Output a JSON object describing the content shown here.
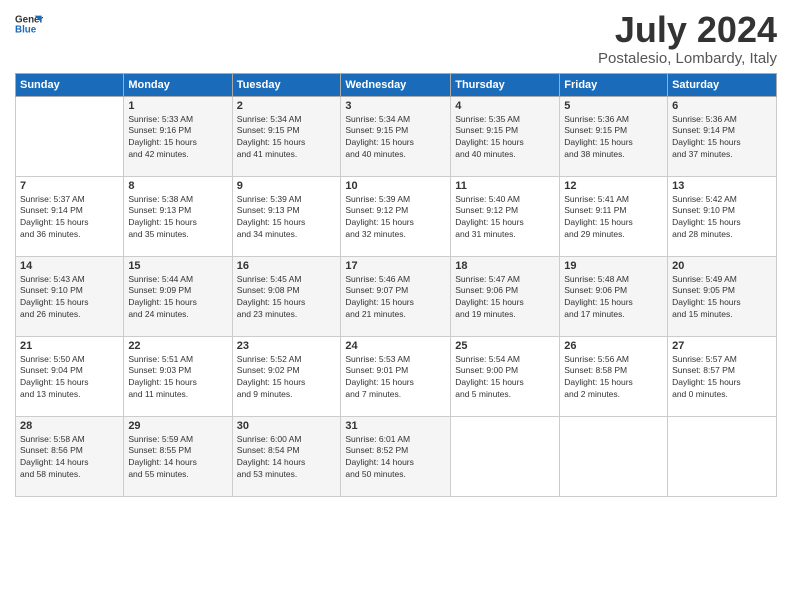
{
  "header": {
    "logo_text_general": "General",
    "logo_text_blue": "Blue",
    "month": "July 2024",
    "location": "Postalesio, Lombardy, Italy"
  },
  "columns": [
    "Sunday",
    "Monday",
    "Tuesday",
    "Wednesday",
    "Thursday",
    "Friday",
    "Saturday"
  ],
  "weeks": [
    [
      {
        "day": "",
        "info": ""
      },
      {
        "day": "1",
        "info": "Sunrise: 5:33 AM\nSunset: 9:16 PM\nDaylight: 15 hours\nand 42 minutes."
      },
      {
        "day": "2",
        "info": "Sunrise: 5:34 AM\nSunset: 9:15 PM\nDaylight: 15 hours\nand 41 minutes."
      },
      {
        "day": "3",
        "info": "Sunrise: 5:34 AM\nSunset: 9:15 PM\nDaylight: 15 hours\nand 40 minutes."
      },
      {
        "day": "4",
        "info": "Sunrise: 5:35 AM\nSunset: 9:15 PM\nDaylight: 15 hours\nand 40 minutes."
      },
      {
        "day": "5",
        "info": "Sunrise: 5:36 AM\nSunset: 9:15 PM\nDaylight: 15 hours\nand 38 minutes."
      },
      {
        "day": "6",
        "info": "Sunrise: 5:36 AM\nSunset: 9:14 PM\nDaylight: 15 hours\nand 37 minutes."
      }
    ],
    [
      {
        "day": "7",
        "info": "Sunrise: 5:37 AM\nSunset: 9:14 PM\nDaylight: 15 hours\nand 36 minutes."
      },
      {
        "day": "8",
        "info": "Sunrise: 5:38 AM\nSunset: 9:13 PM\nDaylight: 15 hours\nand 35 minutes."
      },
      {
        "day": "9",
        "info": "Sunrise: 5:39 AM\nSunset: 9:13 PM\nDaylight: 15 hours\nand 34 minutes."
      },
      {
        "day": "10",
        "info": "Sunrise: 5:39 AM\nSunset: 9:12 PM\nDaylight: 15 hours\nand 32 minutes."
      },
      {
        "day": "11",
        "info": "Sunrise: 5:40 AM\nSunset: 9:12 PM\nDaylight: 15 hours\nand 31 minutes."
      },
      {
        "day": "12",
        "info": "Sunrise: 5:41 AM\nSunset: 9:11 PM\nDaylight: 15 hours\nand 29 minutes."
      },
      {
        "day": "13",
        "info": "Sunrise: 5:42 AM\nSunset: 9:10 PM\nDaylight: 15 hours\nand 28 minutes."
      }
    ],
    [
      {
        "day": "14",
        "info": "Sunrise: 5:43 AM\nSunset: 9:10 PM\nDaylight: 15 hours\nand 26 minutes."
      },
      {
        "day": "15",
        "info": "Sunrise: 5:44 AM\nSunset: 9:09 PM\nDaylight: 15 hours\nand 24 minutes."
      },
      {
        "day": "16",
        "info": "Sunrise: 5:45 AM\nSunset: 9:08 PM\nDaylight: 15 hours\nand 23 minutes."
      },
      {
        "day": "17",
        "info": "Sunrise: 5:46 AM\nSunset: 9:07 PM\nDaylight: 15 hours\nand 21 minutes."
      },
      {
        "day": "18",
        "info": "Sunrise: 5:47 AM\nSunset: 9:06 PM\nDaylight: 15 hours\nand 19 minutes."
      },
      {
        "day": "19",
        "info": "Sunrise: 5:48 AM\nSunset: 9:06 PM\nDaylight: 15 hours\nand 17 minutes."
      },
      {
        "day": "20",
        "info": "Sunrise: 5:49 AM\nSunset: 9:05 PM\nDaylight: 15 hours\nand 15 minutes."
      }
    ],
    [
      {
        "day": "21",
        "info": "Sunrise: 5:50 AM\nSunset: 9:04 PM\nDaylight: 15 hours\nand 13 minutes."
      },
      {
        "day": "22",
        "info": "Sunrise: 5:51 AM\nSunset: 9:03 PM\nDaylight: 15 hours\nand 11 minutes."
      },
      {
        "day": "23",
        "info": "Sunrise: 5:52 AM\nSunset: 9:02 PM\nDaylight: 15 hours\nand 9 minutes."
      },
      {
        "day": "24",
        "info": "Sunrise: 5:53 AM\nSunset: 9:01 PM\nDaylight: 15 hours\nand 7 minutes."
      },
      {
        "day": "25",
        "info": "Sunrise: 5:54 AM\nSunset: 9:00 PM\nDaylight: 15 hours\nand 5 minutes."
      },
      {
        "day": "26",
        "info": "Sunrise: 5:56 AM\nSunset: 8:58 PM\nDaylight: 15 hours\nand 2 minutes."
      },
      {
        "day": "27",
        "info": "Sunrise: 5:57 AM\nSunset: 8:57 PM\nDaylight: 15 hours\nand 0 minutes."
      }
    ],
    [
      {
        "day": "28",
        "info": "Sunrise: 5:58 AM\nSunset: 8:56 PM\nDaylight: 14 hours\nand 58 minutes."
      },
      {
        "day": "29",
        "info": "Sunrise: 5:59 AM\nSunset: 8:55 PM\nDaylight: 14 hours\nand 55 minutes."
      },
      {
        "day": "30",
        "info": "Sunrise: 6:00 AM\nSunset: 8:54 PM\nDaylight: 14 hours\nand 53 minutes."
      },
      {
        "day": "31",
        "info": "Sunrise: 6:01 AM\nSunset: 8:52 PM\nDaylight: 14 hours\nand 50 minutes."
      },
      {
        "day": "",
        "info": ""
      },
      {
        "day": "",
        "info": ""
      },
      {
        "day": "",
        "info": ""
      }
    ]
  ]
}
